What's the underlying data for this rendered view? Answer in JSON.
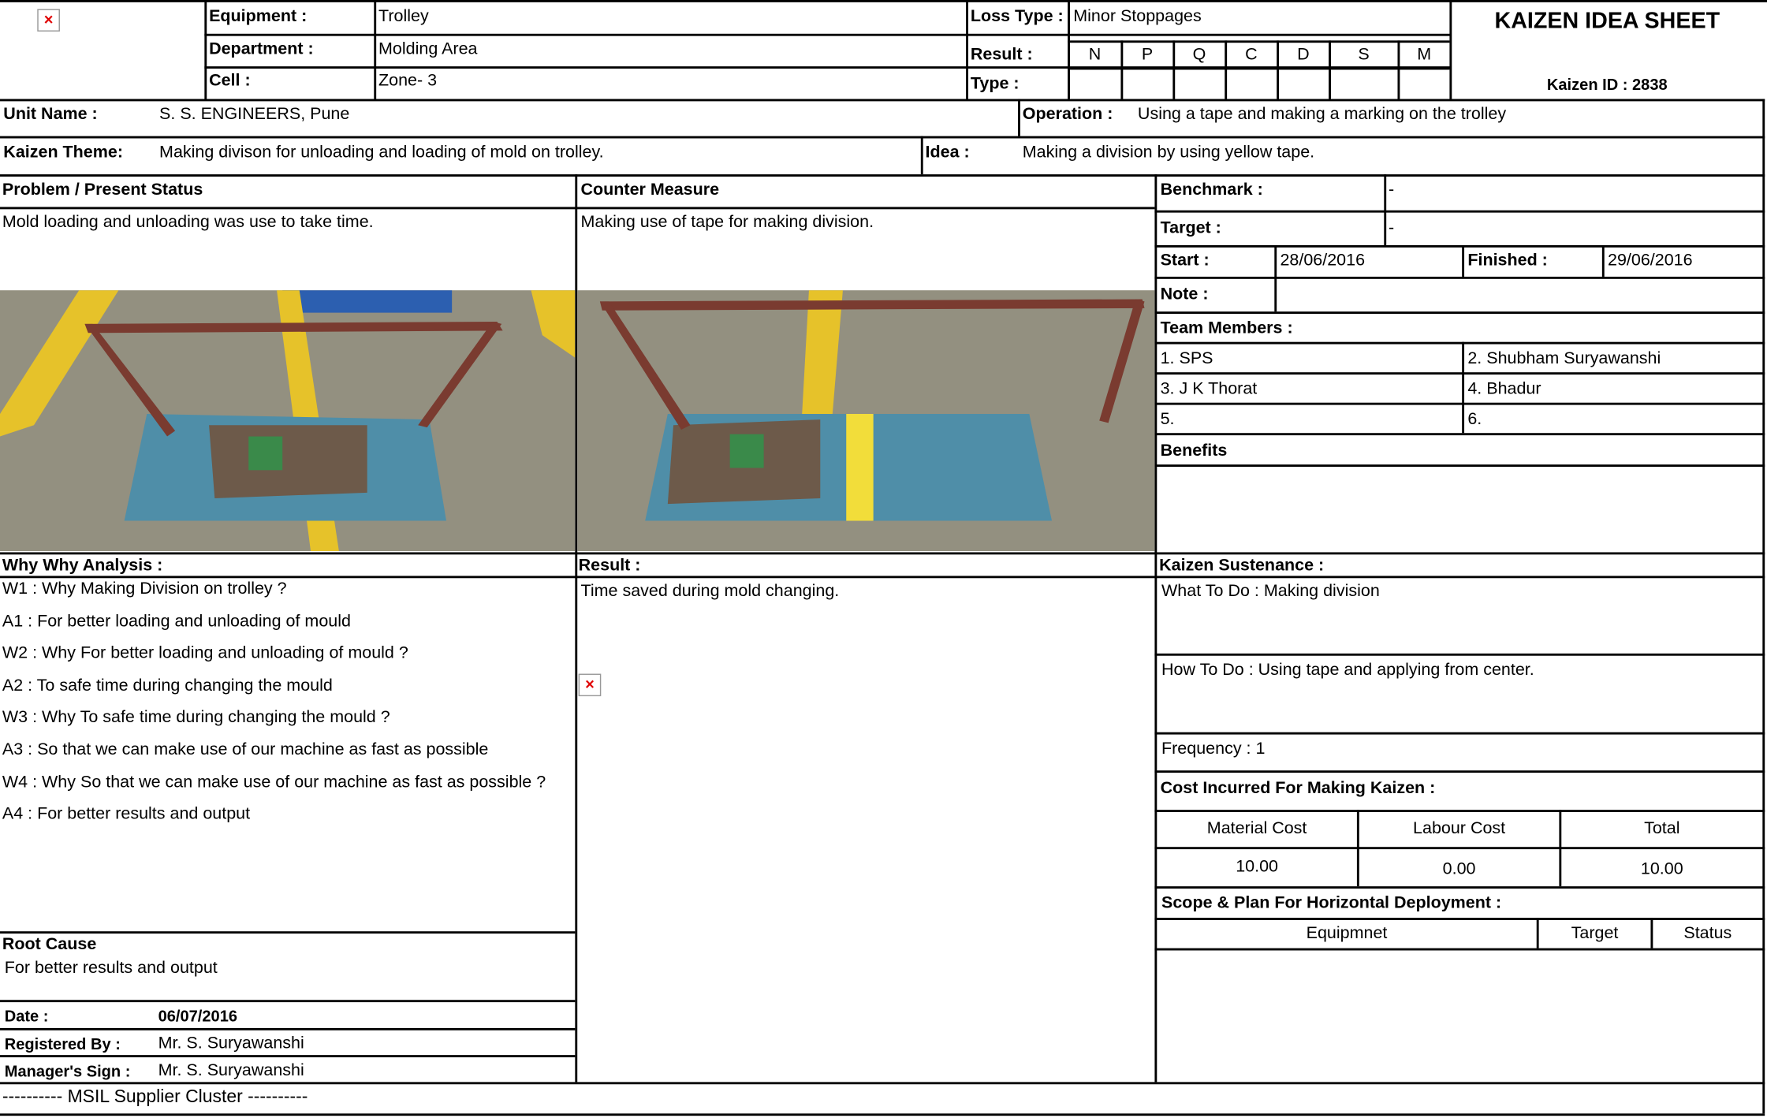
{
  "header": {
    "equipment_label": "Equipment :",
    "equipment_value": "Trolley",
    "department_label": "Department :",
    "department_value": "Molding Area",
    "cell_label": "Cell :",
    "cell_value": "Zone- 3",
    "loss_type_label": "Loss Type :",
    "loss_type_value": "Minor Stoppages",
    "result_label": "Result :",
    "type_label": "Type :",
    "result_columns": [
      "N",
      "P",
      "Q",
      "C",
      "D",
      "S",
      "M"
    ],
    "title": "KAIZEN IDEA SHEET",
    "kaizen_id": "Kaizen ID : 2838"
  },
  "unit": {
    "label": "Unit Name :",
    "value": "S. S. ENGINEERS, Pune",
    "operation_label": "Operation :",
    "operation_value": "Using a tape and making a marking on the trolley"
  },
  "theme": {
    "label": "Kaizen Theme:",
    "value": "Making divison for unloading and loading of mold on trolley.",
    "idea_label": "Idea :",
    "idea_value": "Making a division by using yellow tape."
  },
  "problem": {
    "heading": "Problem / Present Status",
    "text": "Mold loading and unloading was use to take time."
  },
  "counter": {
    "heading": "Counter Measure",
    "text": "Making use of tape for making division."
  },
  "benchmark": {
    "label": "Benchmark :",
    "value": "-"
  },
  "target": {
    "label": "Target :",
    "value": "-"
  },
  "dates": {
    "start_label": "Start :",
    "start_value": "28/06/2016",
    "finished_label": "Finished :",
    "finished_value": "29/06/2016"
  },
  "note": {
    "label": "Note :",
    "value": ""
  },
  "team": {
    "heading": "Team Members :",
    "members": [
      "1. SPS",
      "2. Shubham Suryawanshi",
      "3. J K Thorat",
      "4. Bhadur",
      "5.",
      "6."
    ]
  },
  "benefits": {
    "heading": "Benefits",
    "text": ""
  },
  "why": {
    "heading": "Why Why Analysis :",
    "lines": [
      "W1 : Why Making Division on trolley  ?",
      "A1 : For better loading and unloading of mould",
      "W2 : Why For better loading and unloading of mould ?",
      "A2 : To safe time during changing the mould",
      "W3 : Why To safe time during changing the mould ?",
      "A3 : So that we can make use of our machine as fast as possible",
      "W4 : Why So that we can make use of our machine as fast as possible  ?",
      "A4 : For better results and output"
    ]
  },
  "result": {
    "heading": "Result :",
    "text": "Time saved during mold changing."
  },
  "sustenance": {
    "heading": "Kaizen Sustenance :",
    "what": "What To Do : Making division",
    "how": "How To Do : Using tape and applying from center.",
    "frequency": "Frequency : 1"
  },
  "cost": {
    "heading": "Cost Incurred For Making Kaizen  :",
    "material_label": "Material Cost",
    "labour_label": "Labour Cost",
    "total_label": "Total",
    "material_value": "10.00",
    "labour_value": "0.00",
    "total_value": "10.00"
  },
  "scope": {
    "heading": "Scope & Plan For Horizontal Deployment :",
    "col_equipment": "Equipmnet",
    "col_target": "Target",
    "col_status": "Status"
  },
  "root": {
    "label": "Root Cause",
    "value": "For better results and output"
  },
  "footer_info": {
    "date_label": "Date :",
    "date_value": "06/07/2016",
    "registered_label": "Registered By :",
    "registered_value": "Mr. S. Suryawanshi",
    "manager_label": "Manager's Sign :",
    "manager_value": "Mr. S. Suryawanshi"
  },
  "footer": "---------- MSIL Supplier Cluster   ----------",
  "icons": {
    "broken_image": "broken-image-icon"
  },
  "colors": {
    "floor": "#8c8a7c",
    "yellow_line": "#e6c22a",
    "trolley_frame": "#7a3b30",
    "trolley_base": "#4f8ea8",
    "tape": "#f2dd3a"
  }
}
